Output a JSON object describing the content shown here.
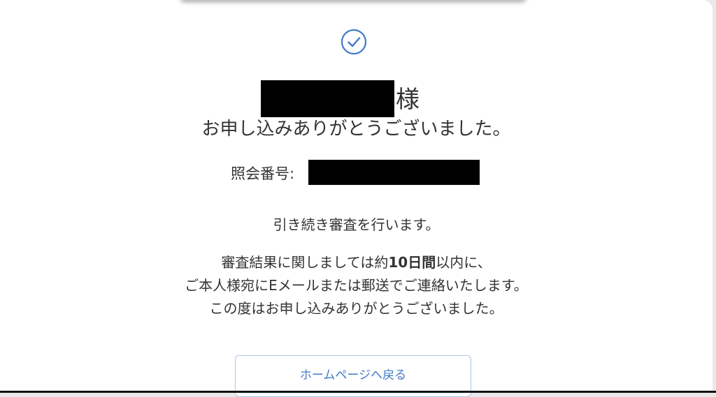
{
  "header": {
    "honorific": "様",
    "thanks": "お申し込みありがとうございました。"
  },
  "reference": {
    "label": "照会番号:"
  },
  "message": {
    "line1": "引き続き審査を行います。",
    "line2_pre": "審査結果に関しましては約",
    "line2_bold": "10日間",
    "line2_post": "以内に、",
    "line3": "ご本人様宛にEメールまたは郵送でご連絡いたします。",
    "line4": "この度はお申し込みありがとうございました。"
  },
  "actions": {
    "home_label": "ホームページへ戻る"
  },
  "colors": {
    "accent": "#3f7ac7",
    "text": "#333333",
    "button_border": "#aac6e8"
  },
  "icons": {
    "check": "check-circle-icon"
  }
}
